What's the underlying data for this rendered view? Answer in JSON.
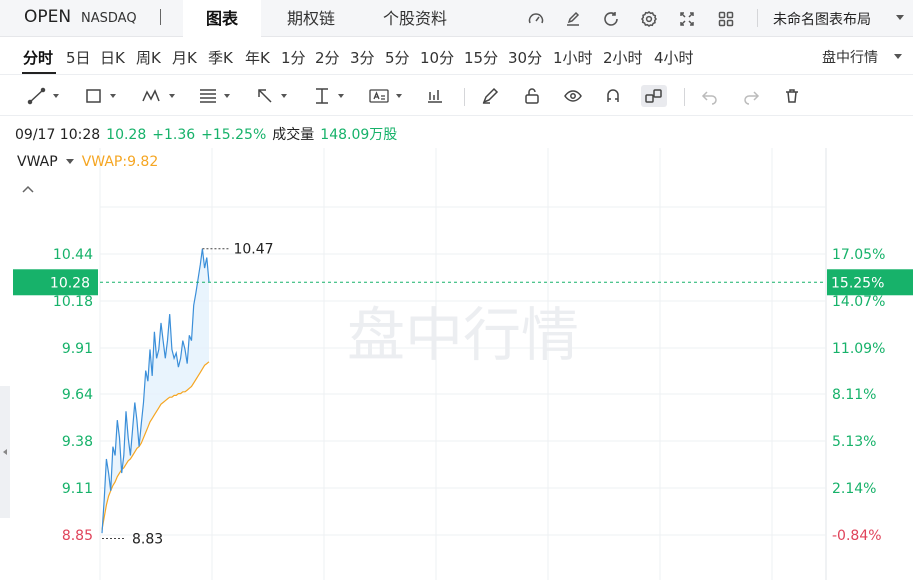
{
  "header": {
    "symbol": "OPEN",
    "exchange": "NASDAQ",
    "tabs": [
      {
        "label": "图表",
        "active": true
      },
      {
        "label": "期权链",
        "active": false
      },
      {
        "label": "个股资料",
        "active": false
      }
    ],
    "layout_label": "未命名图表布局",
    "icons": [
      "speedometer-icon",
      "edit-icon",
      "refresh-icon",
      "settings-icon",
      "fullscreen-icon",
      "grid-icon"
    ]
  },
  "periods": {
    "items": [
      "分时",
      "5日",
      "日K",
      "周K",
      "月K",
      "季K",
      "年K",
      "1分",
      "2分",
      "3分",
      "5分",
      "10分",
      "15分",
      "30分",
      "1小时",
      "2小时",
      "4小时"
    ],
    "active": "分时",
    "session_label": "盘中行情"
  },
  "info": {
    "datetime": "09/17 10:28",
    "price": "10.28",
    "change": "+1.36",
    "change_pct": "+15.25%",
    "volume_label": "成交量",
    "volume": "148.09万股"
  },
  "indicator": {
    "name": "VWAP",
    "value_label": "VWAP:9.82"
  },
  "watermark": "盘中行情",
  "colors": {
    "up": "#17b26a",
    "down": "#e0435a",
    "price_line": "#3b8fd9",
    "vwap_line": "#f5a623",
    "grid": "#eef0f3"
  },
  "chart_data": {
    "type": "line",
    "y_axis_left": [
      "10.44",
      "10.18",
      "9.91",
      "9.64",
      "9.38",
      "9.11",
      "8.85"
    ],
    "y_axis_right": [
      "17.05%",
      "14.07%",
      "11.09%",
      "8.11%",
      "5.13%",
      "2.14%",
      "-0.84%"
    ],
    "ylim": [
      8.85,
      10.44
    ],
    "current_price": "10.28",
    "current_pct": "15.25%",
    "high_label": "10.47",
    "low_label": "8.83",
    "series": [
      {
        "name": "VWAP",
        "values": [
          8.88,
          8.95,
          9.02,
          9.07,
          9.1,
          9.13,
          9.15,
          9.18,
          9.2,
          9.22,
          9.23,
          9.25,
          9.27,
          9.28,
          9.3,
          9.32,
          9.34,
          9.35,
          9.37,
          9.4,
          9.43,
          9.46,
          9.49,
          9.51,
          9.53,
          9.55,
          9.57,
          9.59,
          9.6,
          9.61,
          9.62,
          9.63,
          9.63,
          9.64,
          9.64,
          9.65,
          9.65,
          9.66,
          9.66,
          9.67,
          9.68,
          9.69,
          9.71,
          9.73,
          9.75,
          9.77,
          9.79,
          9.81,
          9.82,
          9.83
        ]
      },
      {
        "values": [
          8.86,
          9.05,
          9.28,
          9.2,
          9.1,
          9.35,
          9.3,
          9.5,
          9.4,
          9.2,
          9.3,
          9.55,
          9.4,
          9.3,
          9.45,
          9.6,
          9.5,
          9.35,
          9.48,
          9.6,
          9.78,
          9.72,
          9.9,
          9.75,
          10.0,
          9.85,
          9.9,
          10.05,
          9.95,
          9.85,
          9.95,
          10.1,
          9.9,
          9.85,
          9.88,
          9.8,
          9.85,
          9.95,
          9.9,
          9.82,
          9.98,
          9.95,
          10.15,
          10.22,
          10.3,
          10.38,
          10.47,
          10.36,
          10.42,
          10.28
        ]
      }
    ]
  }
}
